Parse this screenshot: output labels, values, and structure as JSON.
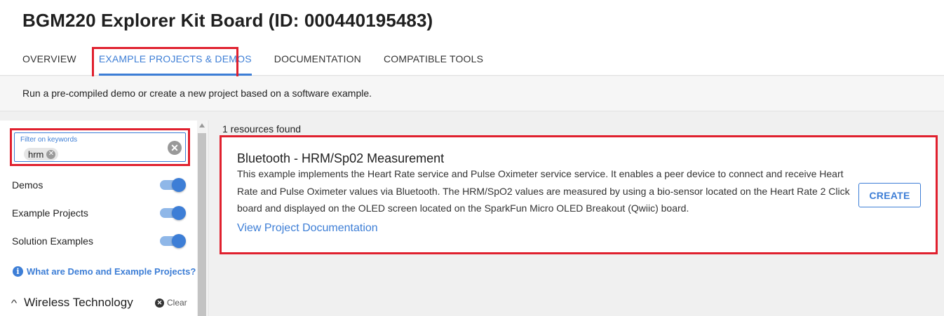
{
  "header": {
    "title": "BGM220 Explorer Kit Board (ID: 000440195483)",
    "tabs": [
      {
        "label": "OVERVIEW"
      },
      {
        "label": "EXAMPLE PROJECTS & DEMOS"
      },
      {
        "label": "DOCUMENTATION"
      },
      {
        "label": "COMPATIBLE TOOLS"
      }
    ],
    "active_tab": "EXAMPLE PROJECTS & DEMOS"
  },
  "subheader": {
    "text": "Run a pre-compiled demo or create a new project based on a software example."
  },
  "sidebar": {
    "filter": {
      "label": "Filter on keywords",
      "chip": "hrm"
    },
    "toggles": [
      {
        "label": "Demos",
        "on": true
      },
      {
        "label": "Example Projects",
        "on": true
      },
      {
        "label": "Solution Examples",
        "on": true
      }
    ],
    "info_link": "What are Demo and Example Projects?",
    "section": {
      "title": "Wireless Technology",
      "clear_label": "Clear"
    }
  },
  "results": {
    "count_text": "1 resources found",
    "cards": [
      {
        "title": "Bluetooth - HRM/Sp02 Measurement",
        "description": "This example implements the Heart Rate service and Pulse Oximeter service service. It enables a peer device to connect and receive Heart Rate and Pulse Oximeter values via Bluetooth. The HRM/SpO2 values are measured by using a bio-sensor located on the Heart Rate 2 Click board and displayed on the OLED screen located on the SparkFun Micro OLED Breakout (Qwiic) board.",
        "link": "View Project Documentation",
        "button": "CREATE"
      }
    ]
  },
  "colors": {
    "accent": "#3d7ed6",
    "highlight": "#e0202e"
  }
}
